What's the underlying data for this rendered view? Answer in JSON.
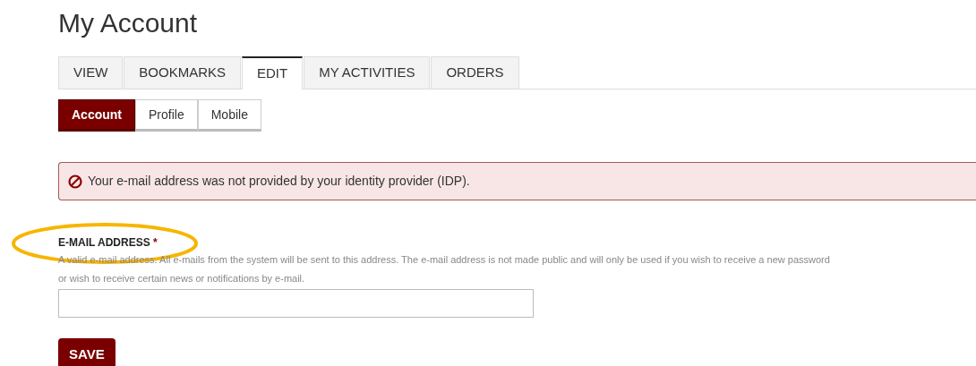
{
  "page": {
    "title": "My Account"
  },
  "tabs": [
    {
      "label": "VIEW",
      "selected": false
    },
    {
      "label": "BOOKMARKS",
      "selected": false
    },
    {
      "label": "EDIT",
      "selected": true
    },
    {
      "label": "MY ACTIVITIES",
      "selected": false
    },
    {
      "label": "ORDERS",
      "selected": false
    }
  ],
  "subtabs": [
    {
      "label": "Account",
      "selected": true
    },
    {
      "label": "Profile",
      "selected": false
    },
    {
      "label": "Mobile",
      "selected": false
    }
  ],
  "alert": {
    "message": "Your e-mail address was not provided by your identity provider (IDP)."
  },
  "form": {
    "label": "E-MAIL ADDRESS",
    "required_mark": "*",
    "highlighted": true,
    "description_lines": [
      "A valid e-mail address. All e-mails from the system will be sent to this address. The e-mail address is not made public and will only be used if you wish to receive a new password",
      "or wish to receive certain news or notifications by e-mail."
    ],
    "save_label": "SAVE"
  }
}
